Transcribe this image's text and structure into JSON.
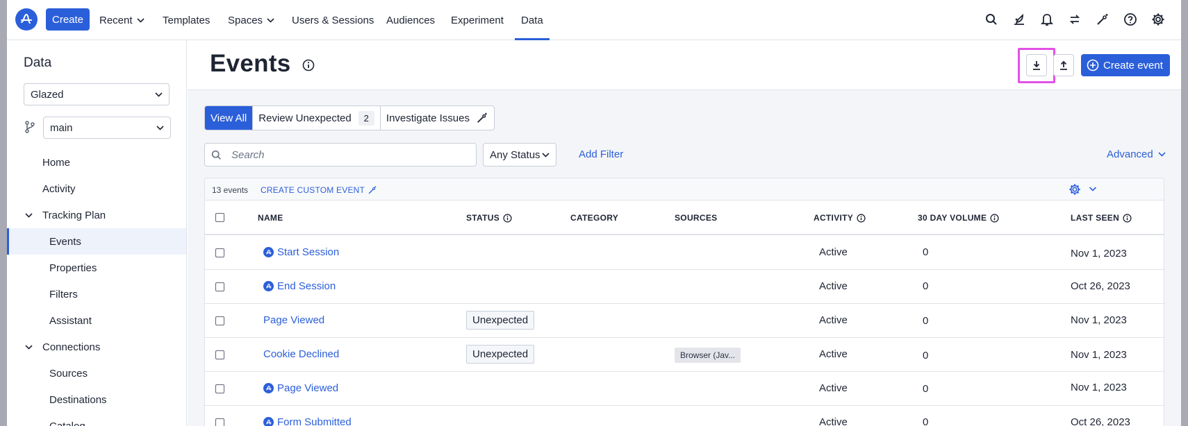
{
  "nav": {
    "create": "Create",
    "recent": "Recent",
    "templates": "Templates",
    "spaces": "Spaces",
    "users_sessions": "Users & Sessions",
    "audiences": "Audiences",
    "experiment": "Experiment",
    "data": "Data"
  },
  "sidebar": {
    "title": "Data",
    "project": "Glazed",
    "branch": "main",
    "items": {
      "home": "Home",
      "activity": "Activity",
      "tracking_plan": "Tracking Plan",
      "events": "Events",
      "properties": "Properties",
      "filters": "Filters",
      "assistant": "Assistant",
      "connections": "Connections",
      "sources": "Sources",
      "destinations": "Destinations",
      "catalog": "Catalog"
    }
  },
  "header": {
    "title": "Events",
    "create_event": "Create event"
  },
  "tabs": {
    "view_all": "View All",
    "review_unexpected": "Review Unexpected",
    "review_count": "2",
    "investigate": "Investigate Issues"
  },
  "filters": {
    "search_placeholder": "Search",
    "status": "Any Status",
    "add_filter": "Add Filter",
    "advanced": "Advanced"
  },
  "table": {
    "count": "13 events",
    "create_custom": "CREATE CUSTOM EVENT",
    "columns": {
      "name": "NAME",
      "status": "STATUS",
      "category": "CATEGORY",
      "sources": "SOURCES",
      "activity": "ACTIVITY",
      "volume": "30 DAY VOLUME",
      "last_seen": "LAST SEEN"
    },
    "rows": [
      {
        "name": "Start Session",
        "status": "",
        "source": "",
        "activity": "Active",
        "volume": "0",
        "last_seen": "Nov 1, 2023"
      },
      {
        "name": "End Session",
        "status": "",
        "source": "",
        "activity": "Active",
        "volume": "0",
        "last_seen": "Oct 26, 2023"
      },
      {
        "name": "Page Viewed",
        "status": "Unexpected",
        "source": "",
        "activity": "Active",
        "volume": "0",
        "last_seen": "Nov 1, 2023"
      },
      {
        "name": "Cookie Declined",
        "status": "Unexpected",
        "source": "Browser (Jav...",
        "activity": "Active",
        "volume": "0",
        "last_seen": "Nov 1, 2023"
      },
      {
        "name": "Page Viewed",
        "status": "",
        "source": "",
        "activity": "Active",
        "volume": "0",
        "last_seen": "Nov 1, 2023"
      },
      {
        "name": "Form Submitted",
        "status": "",
        "source": "",
        "activity": "Active",
        "volume": "0",
        "last_seen": "Oct 26, 2023"
      }
    ]
  },
  "colors": {
    "accent": "#2b5fd9",
    "highlight": "#e052e6"
  }
}
